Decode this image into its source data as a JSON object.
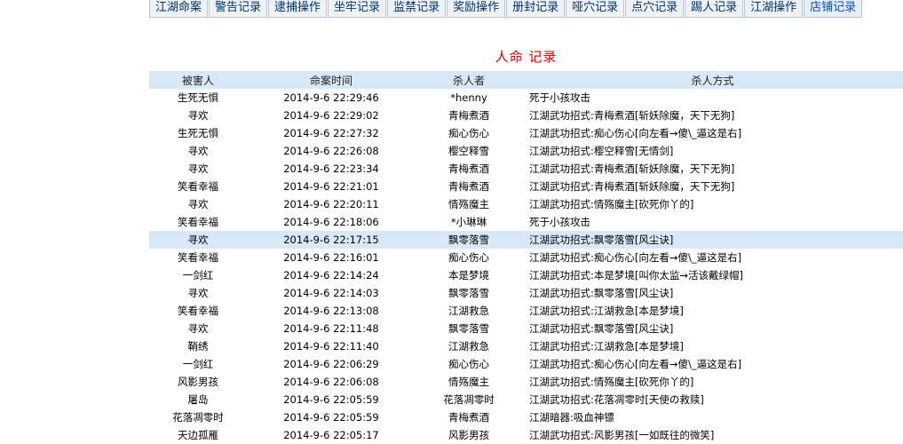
{
  "nav": {
    "tabs": [
      "江湖命案",
      "警告记录",
      "逮捕操作",
      "坐牢记录",
      "监禁记录",
      "奖励操作",
      "册封记录",
      "哑穴记录",
      "点穴记录",
      "踢人记录",
      "江湖操作",
      "店铺记录"
    ]
  },
  "page": {
    "title": "人命 记录"
  },
  "table": {
    "headers": {
      "victim": "被害人",
      "time": "命案时间",
      "killer": "杀人者",
      "method": "杀人方式"
    },
    "rows": [
      {
        "victim": "生死无惧",
        "time": "2014-9-6 22:29:46",
        "killer": "*henny",
        "method": "死于小孩攻击"
      },
      {
        "victim": "寻欢",
        "time": "2014-9-6 22:29:02",
        "killer": "青梅煮酒",
        "method": "江湖武功招式:青梅煮酒[斩妖除魔，天下无狗]"
      },
      {
        "victim": "生死无惧",
        "time": "2014-9-6 22:27:32",
        "killer": "痴心伤心",
        "method": "江湖武功招式:痴心伤心[向左看→傻\\_逼这是右]"
      },
      {
        "victim": "寻欢",
        "time": "2014-9-6 22:26:08",
        "killer": "樱空释雪",
        "method": "江湖武功招式:樱空释雪[无情剑]"
      },
      {
        "victim": "寻欢",
        "time": "2014-9-6 22:23:34",
        "killer": "青梅煮酒",
        "method": "江湖武功招式:青梅煮酒[斩妖除魔，天下无狗]"
      },
      {
        "victim": "笑看幸福",
        "time": "2014-9-6 22:21:01",
        "killer": "青梅煮酒",
        "method": "江湖武功招式:青梅煮酒[斩妖除魔，天下无狗]"
      },
      {
        "victim": "寻欢",
        "time": "2014-9-6 22:20:11",
        "killer": "情殇魔主",
        "method": "江湖武功招式:情殇魔主[砍死你丫的]"
      },
      {
        "victim": "笑看幸福",
        "time": "2014-9-6 22:18:06",
        "killer": "*小琳琳",
        "method": "死于小孩攻击"
      },
      {
        "victim": "寻欢",
        "time": "2014-9-6 22:17:15",
        "killer": "飘零落雪",
        "method": "江湖武功招式:飘零落雪[风尘诀]"
      },
      {
        "victim": "笑看幸福",
        "time": "2014-9-6 22:16:01",
        "killer": "痴心伤心",
        "method": "江湖武功招式:痴心伤心[向左看→傻\\_逼这是右]"
      },
      {
        "victim": "一剑红",
        "time": "2014-9-6 22:14:24",
        "killer": "本是梦境",
        "method": "江湖武功招式:本是梦境[叫你太监→活该戴绿帽]"
      },
      {
        "victim": "寻欢",
        "time": "2014-9-6 22:14:03",
        "killer": "飘零落雪",
        "method": "江湖武功招式:飘零落雪[风尘诀]"
      },
      {
        "victim": "笑看幸福",
        "time": "2014-9-6 22:13:08",
        "killer": "江湖救急",
        "method": "江湖武功招式:江湖救急[本是梦境]"
      },
      {
        "victim": "寻欢",
        "time": "2014-9-6 22:11:48",
        "killer": "飘零落雪",
        "method": "江湖武功招式:飘零落雪[风尘诀]"
      },
      {
        "victim": "鞘绣",
        "time": "2014-9-6 22:11:40",
        "killer": "江湖救急",
        "method": "江湖武功招式:江湖救急[本是梦境]"
      },
      {
        "victim": "一剑红",
        "time": "2014-9-6 22:06:29",
        "killer": "痴心伤心",
        "method": "江湖武功招式:痴心伤心[向左看→傻\\_逼这是右]"
      },
      {
        "victim": "风影男孩",
        "time": "2014-9-6 22:06:08",
        "killer": "情殇魔主",
        "method": "江湖武功招式:情殇魔主[砍死你丫的]"
      },
      {
        "victim": "屠岛",
        "time": "2014-9-6 22:05:59",
        "killer": "花落凋零时",
        "method": "江湖武功招式:花落凋零时[天使の救赎]"
      },
      {
        "victim": "花落凋零时",
        "time": "2014-9-6 22:05:59",
        "killer": "青梅煮酒",
        "method": "江湖暗器:吸血神镖"
      },
      {
        "victim": "天边孤雁",
        "time": "2014-9-6 22:05:17",
        "killer": "风影男孩",
        "method": "江湖武功招式:风影男孩[一如既往的微笑]"
      }
    ],
    "highlighted_row": 8
  },
  "colors": {
    "header_bg": "#d9e8f6",
    "title": "#e00000"
  }
}
